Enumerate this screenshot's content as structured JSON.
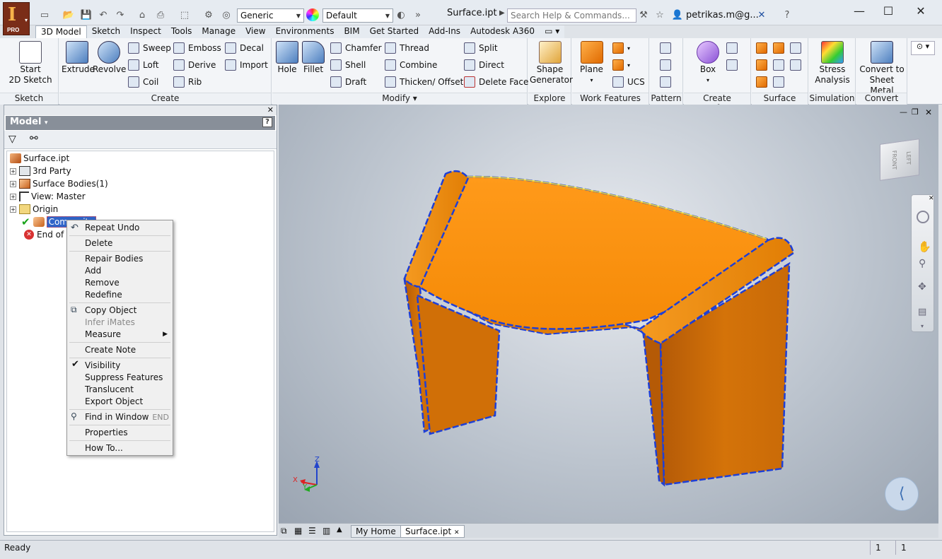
{
  "app": {
    "title": "Surface.ipt",
    "edition": "PRO"
  },
  "quick_access": {
    "material": "Generic",
    "appearance": "Default"
  },
  "search": {
    "placeholder": "Search Help & Commands..."
  },
  "user": {
    "name": "petrikas.m@g..."
  },
  "tabs": [
    "3D Model",
    "Sketch",
    "Inspect",
    "Tools",
    "Manage",
    "View",
    "Environments",
    "BIM",
    "Get Started",
    "Add-Ins",
    "Autodesk A360"
  ],
  "ribbon": {
    "sketch": {
      "title": "Sketch",
      "start": "Start",
      "sketch2d": "2D Sketch"
    },
    "create": {
      "title": "Create",
      "extrude": "Extrude",
      "revolve": "Revolve",
      "sweep": "Sweep",
      "loft": "Loft",
      "coil": "Coil",
      "emboss": "Emboss",
      "derive": "Derive",
      "rib": "Rib",
      "decal": "Decal",
      "import": "Import"
    },
    "modify": {
      "title": "Modify",
      "hole": "Hole",
      "fillet": "Fillet",
      "chamfer": "Chamfer",
      "shell": "Shell",
      "draft": "Draft",
      "thread": "Thread",
      "combine": "Combine",
      "thicken": "Thicken/ Offset",
      "split": "Split",
      "direct": "Direct",
      "delete_face": "Delete Face"
    },
    "explore": {
      "title": "Explore",
      "shape1": "Shape",
      "shape2": "Generator"
    },
    "work": {
      "title": "Work Features",
      "plane": "Plane",
      "ucs": "UCS"
    },
    "pattern": {
      "title": "Pattern"
    },
    "freeform": {
      "title": "Create Freeform",
      "box": "Box"
    },
    "surface": {
      "title": "Surface"
    },
    "simulation": {
      "title": "Simulation",
      "stress1": "Stress",
      "stress2": "Analysis"
    },
    "convert": {
      "title": "Convert",
      "sm1": "Convert to",
      "sm2": "Sheet Metal"
    }
  },
  "browser": {
    "header": "Model",
    "tree": [
      {
        "label": "Surface.ipt"
      },
      {
        "label": "3rd Party"
      },
      {
        "label": "Surface Bodies(1)"
      },
      {
        "label": "View: Master"
      },
      {
        "label": "Origin"
      },
      {
        "label": "Composite"
      },
      {
        "label": "End of Part"
      }
    ]
  },
  "context_menu": {
    "repeat_undo": "Repeat Undo",
    "delete": "Delete",
    "repair_bodies": "Repair Bodies",
    "add": "Add",
    "remove": "Remove",
    "redefine": "Redefine",
    "copy_object": "Copy Object",
    "infer_imates": "Infer iMates",
    "measure": "Measure",
    "create_note": "Create Note",
    "visibility": "Visibility",
    "suppress_features": "Suppress Features",
    "translucent": "Translucent",
    "export_object": "Export Object",
    "find_in_window": "Find in Window",
    "find_shortcut": "END",
    "properties": "Properties",
    "how_to": "How To..."
  },
  "viewcube": {
    "front": "FRONT",
    "right": "LEFT"
  },
  "triad": {
    "x": "X",
    "y": "Y",
    "z": "Z"
  },
  "doc_tabs": {
    "home": "My Home",
    "doc": "Surface.ipt"
  },
  "status": {
    "text": "Ready",
    "count1": "1",
    "count2": "1"
  },
  "colors": {
    "body": "#f58a07",
    "edge": "#1e3fd6",
    "tab_accent": "#1f6fb8"
  }
}
